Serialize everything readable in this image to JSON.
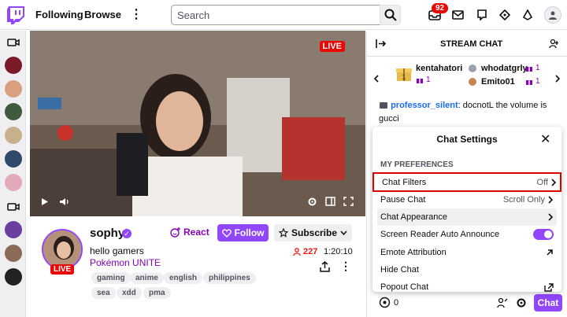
{
  "topbar": {
    "following_label": "Following",
    "browse_label": "Browse",
    "search_placeholder": "Search",
    "notifications_count": "92"
  },
  "video": {
    "live_label": "LIVE"
  },
  "channel": {
    "name": "sophy",
    "stream_title": "hello gamers",
    "game": "Pokémon UNITE",
    "live_label": "LIVE",
    "react_label": "React",
    "follow_label": "Follow",
    "subscribe_label": "Subscribe",
    "viewers": "227",
    "uptime": "1:20:10",
    "tags": [
      "gaming",
      "anime",
      "english",
      "philippines",
      "sea",
      "xdd",
      "pma"
    ]
  },
  "chat": {
    "title": "STREAM CHAT",
    "gifters": [
      {
        "name": "kentahatori",
        "count": "1"
      },
      {
        "name": "whodatgrly",
        "count": "1"
      },
      {
        "name": "Emito01",
        "count": "1"
      }
    ],
    "message": {
      "user": "professor_silent",
      "text": "docnotL the volume is gucci"
    },
    "points": "0",
    "chat_button": "Chat"
  },
  "settings": {
    "title": "Chat Settings",
    "section": "MY PREFERENCES",
    "rows": [
      {
        "label": "Chat Filters",
        "value": "Off"
      },
      {
        "label": "Pause Chat",
        "value": "Scroll Only"
      },
      {
        "label": "Chat Appearance",
        "value": ""
      },
      {
        "label": "Screen Reader Auto Announce",
        "value": ""
      },
      {
        "label": "Emote Attribution",
        "value": ""
      },
      {
        "label": "Hide Chat",
        "value": ""
      },
      {
        "label": "Popout Chat",
        "value": ""
      }
    ]
  },
  "colors": {
    "accent": "#9147ff",
    "live": "#eb0400",
    "highlight": "#d70000"
  }
}
